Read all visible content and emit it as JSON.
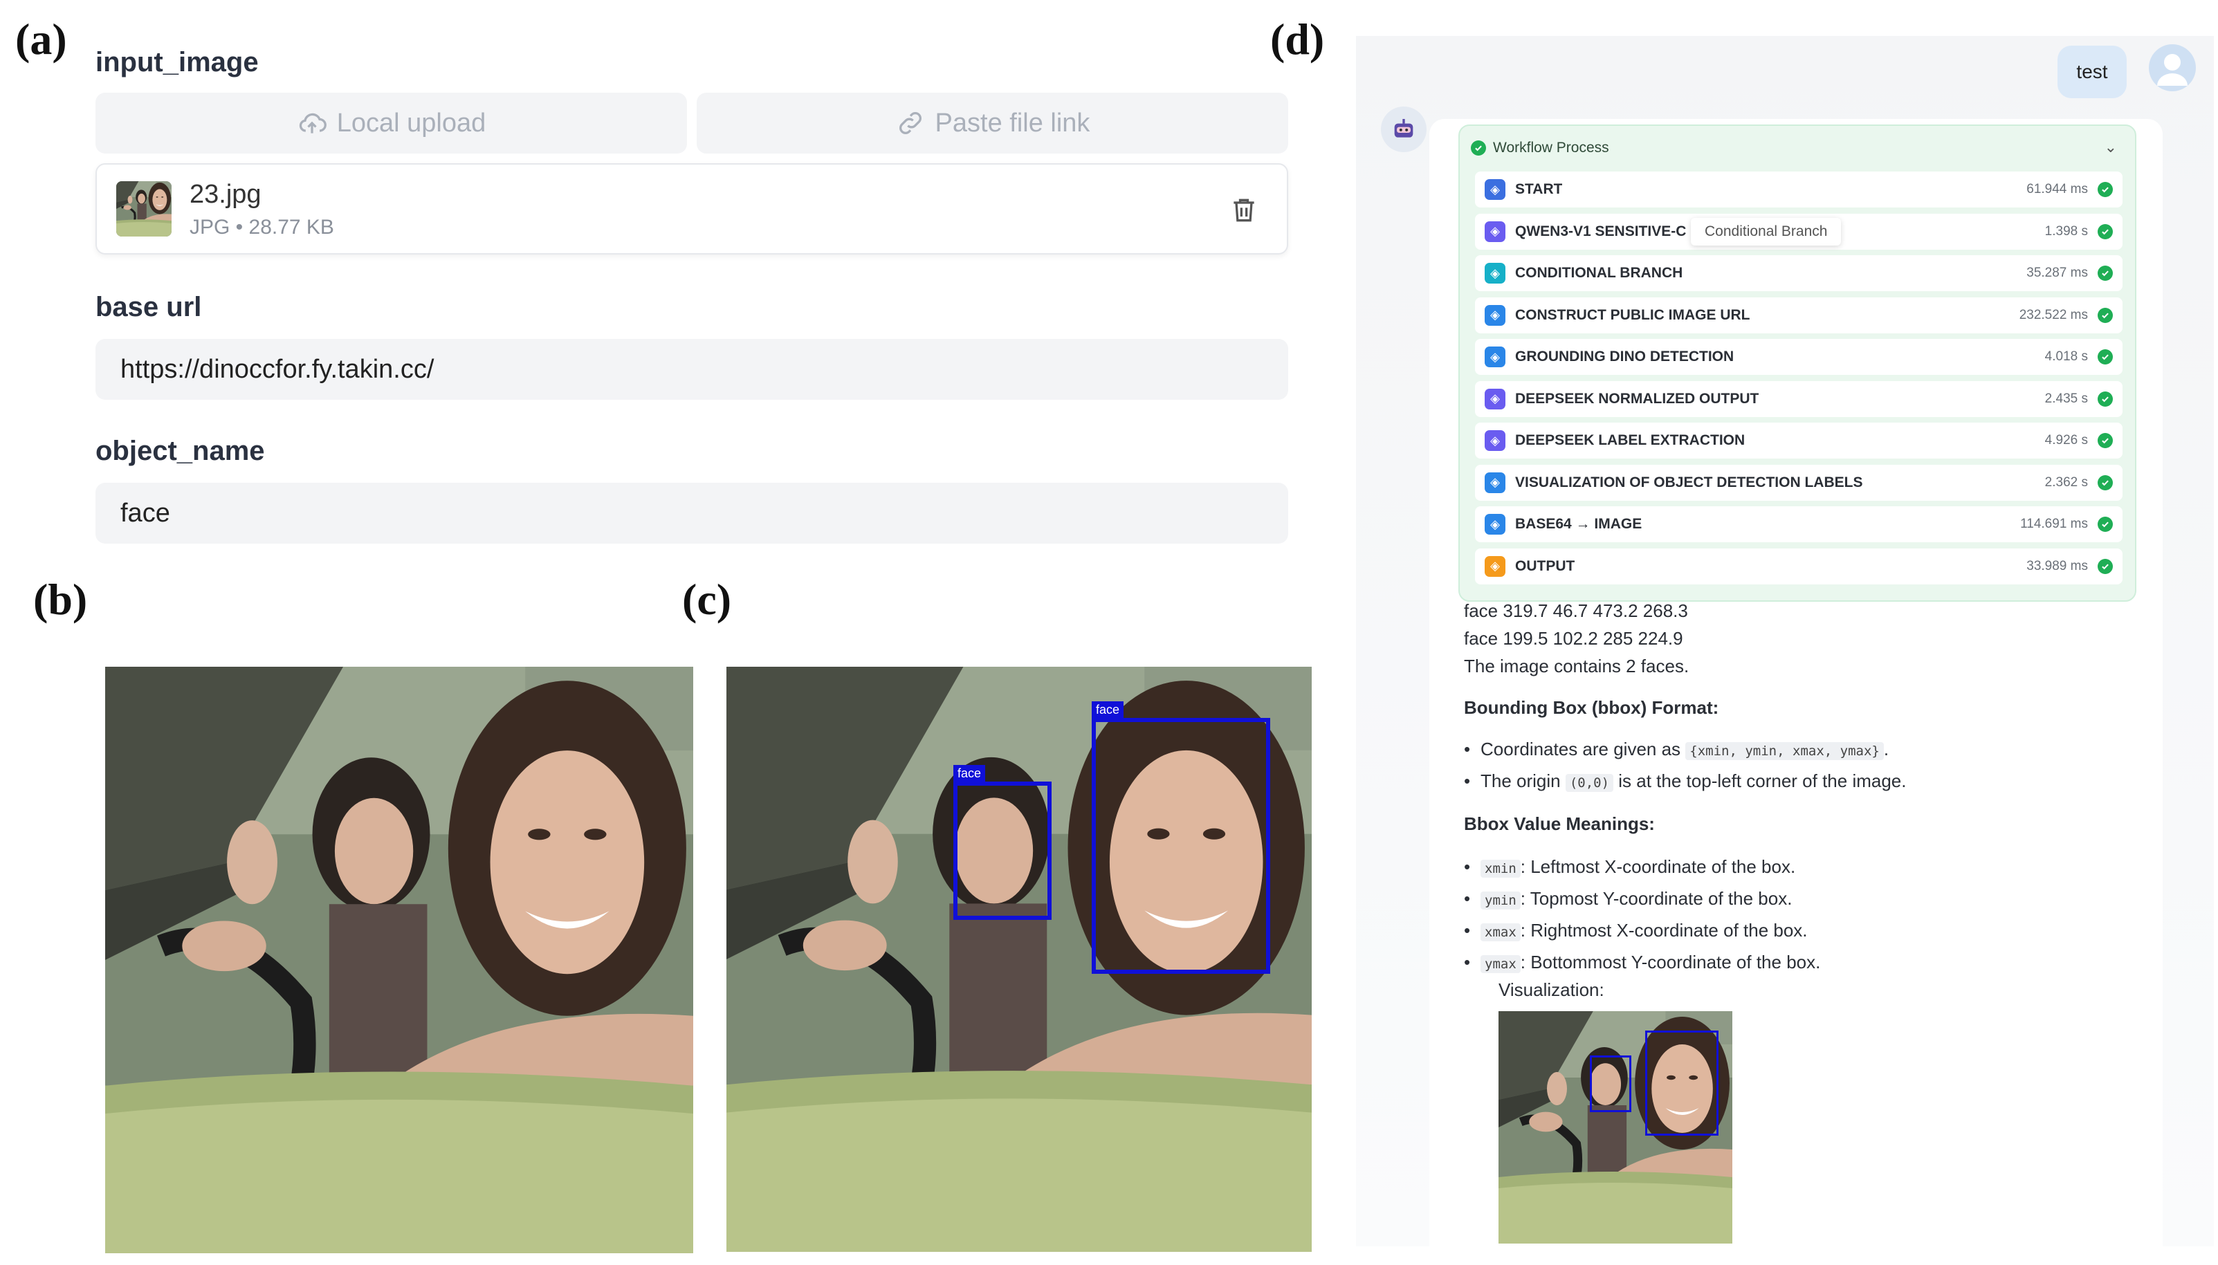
{
  "panel_labels": {
    "a": "(a)",
    "b": "(b)",
    "c": "(c)",
    "d": "(d)"
  },
  "input_image": {
    "label": "input_image",
    "local_upload": "Local upload",
    "paste_link": "Paste file link",
    "file_name": "23.jpg",
    "file_meta": "JPG • 28.77 KB"
  },
  "base_url": {
    "label": "base url",
    "value": "https://dinoccfor.fy.takin.cc/"
  },
  "object_name": {
    "label": "object_name",
    "value": "face"
  },
  "detection_tag": "face",
  "chat": {
    "user_message": "test",
    "workflow": {
      "title": "Workflow Process",
      "tooltip": "Conditional Branch",
      "steps": [
        {
          "name": "START",
          "time": "61.944 ms",
          "color": "#3b6fe0"
        },
        {
          "name": "QWEN3-V1 SENSITIVE-C",
          "time": "1.398 s",
          "color": "#6a5cf0"
        },
        {
          "name": "CONDITIONAL BRANCH",
          "time": "35.287 ms",
          "color": "#16b0c8"
        },
        {
          "name": "CONSTRUCT PUBLIC IMAGE URL",
          "time": "232.522 ms",
          "color": "#2a86e8"
        },
        {
          "name": "GROUNDING DINO DETECTION",
          "time": "4.018 s",
          "color": "#2a86e8"
        },
        {
          "name": "DEEPSEEK NORMALIZED OUTPUT",
          "time": "2.435 s",
          "color": "#6a5cf0"
        },
        {
          "name": "DEEPSEEK LABEL EXTRACTION",
          "time": "4.926 s",
          "color": "#6a5cf0"
        },
        {
          "name": "VISUALIZATION OF OBJECT DETECTION LABELS",
          "time": "2.362 s",
          "color": "#2a86e8"
        },
        {
          "name": "BASE64 → IMAGE",
          "time": "114.691 ms",
          "color": "#2a86e8"
        },
        {
          "name": "OUTPUT",
          "time": "33.989 ms",
          "color": "#f59a1b"
        }
      ]
    },
    "result_lines": [
      "face 319.7 46.7 473.2 268.3",
      "face 199.5 102.2 285 224.9",
      "The image contains 2 faces."
    ],
    "bbox_format": {
      "heading": "Bounding Box (bbox) Format:",
      "b1_pre": "Coordinates are given as ",
      "b1_code": "{xmin, ymin, xmax, ymax}",
      "b1_post": ".",
      "b2_pre": "The origin ",
      "b2_code": "(0,0)",
      "b2_post": " is at the top-left corner of the image."
    },
    "bbox_meanings": {
      "heading": "Bbox Value Meanings:",
      "items": [
        {
          "code": "xmin",
          "text": ": Leftmost X-coordinate of the box."
        },
        {
          "code": "ymin",
          "text": ": Topmost Y-coordinate of the box."
        },
        {
          "code": "xmax",
          "text": ": Rightmost X-coordinate of the box."
        },
        {
          "code": "ymax",
          "text": ": Bottommost Y-coordinate of the box."
        }
      ]
    },
    "visualization_label": "Visualization:"
  }
}
